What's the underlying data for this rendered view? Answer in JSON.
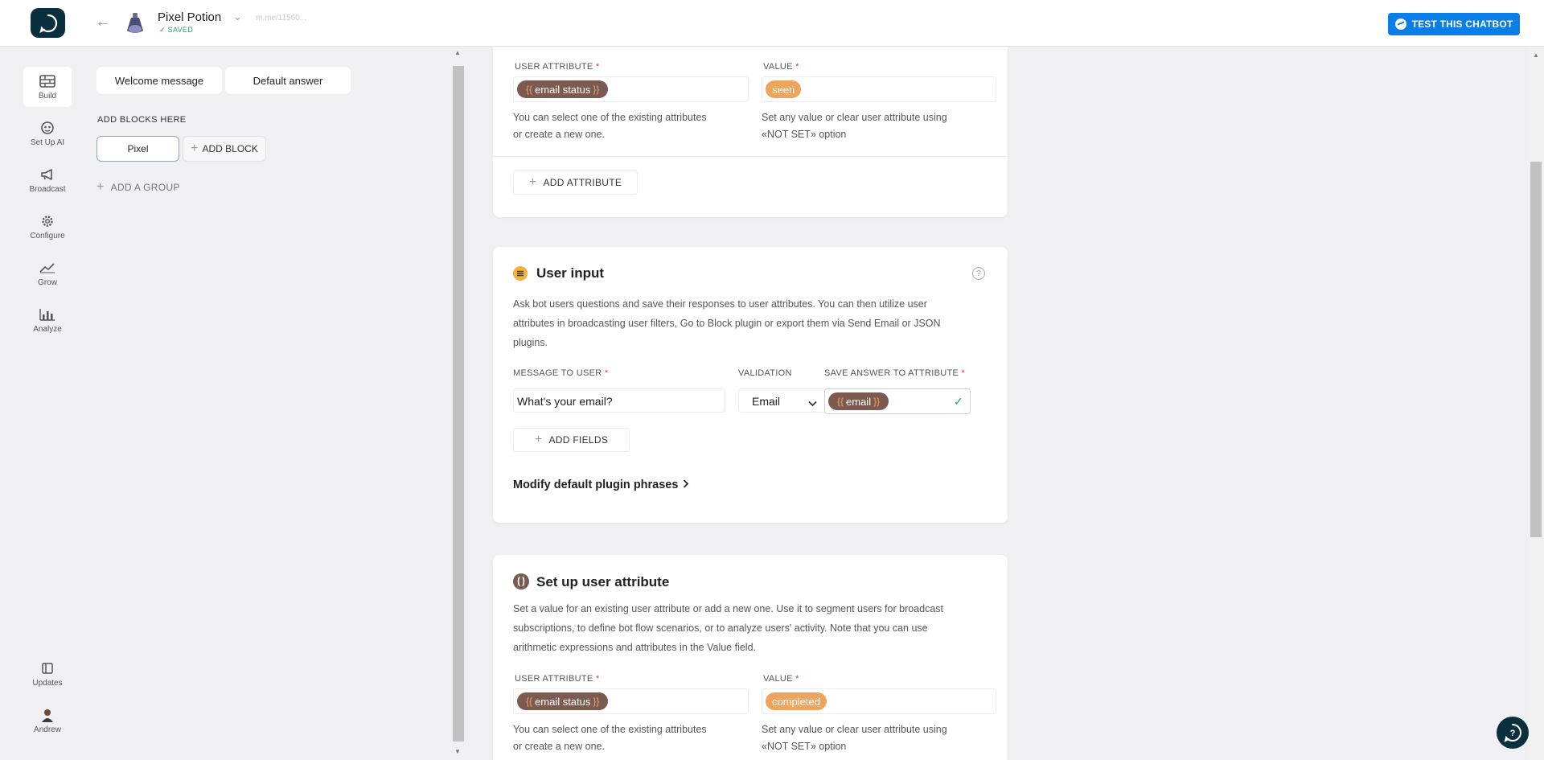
{
  "topbar": {
    "bot_name": "Pixel Potion",
    "saved_status": "SAVED",
    "bot_link": "m.me/11560...",
    "test_button": "TEST THIS CHATBOT"
  },
  "sidebar": {
    "items": [
      {
        "label": "Build",
        "icon": "build-icon",
        "active": true
      },
      {
        "label": "Set Up AI",
        "icon": "ai-icon",
        "active": false
      },
      {
        "label": "Broadcast",
        "icon": "megaphone-icon",
        "active": false
      },
      {
        "label": "Configure",
        "icon": "gear-icon",
        "active": false
      },
      {
        "label": "Grow",
        "icon": "grow-icon",
        "active": false
      },
      {
        "label": "Analyze",
        "icon": "chart-icon",
        "active": false
      }
    ],
    "updates_label": "Updates",
    "user_label": "Andrew"
  },
  "blocks_panel": {
    "welcome_tab": "Welcome message",
    "default_tab": "Default answer",
    "add_blocks_label": "ADD BLOCKS HERE",
    "pixel_block": "Pixel",
    "add_block": "ADD BLOCK",
    "add_group": "ADD A GROUP"
  },
  "attr_card_top": {
    "attr_label": "USER ATTRIBUTE",
    "value_label": "VALUE",
    "attr_chip": "email status",
    "value_chip": "seen",
    "attr_help_1": "You can select one of the existing attributes",
    "attr_help_2": "or create a new one.",
    "value_help_1": "Set any value or clear user attribute using",
    "value_help_2": "«NOT SET» option",
    "add_attribute": "ADD ATTRIBUTE"
  },
  "user_input_card": {
    "title": "User input",
    "desc_1": "Ask bot users questions and save their responses to user attributes. You can then utilize user",
    "desc_2": "attributes in broadcasting user filters, Go to Block plugin or export them via Send Email or JSON",
    "desc_3": "plugins.",
    "message_label": "MESSAGE TO USER",
    "validation_label": "VALIDATION",
    "save_label": "SAVE ANSWER TO ATTRIBUTE",
    "message_value": "What's your email?",
    "validation_value": "Email",
    "save_chip": "email",
    "add_fields": "ADD FIELDS",
    "modify_phrases": "Modify default plugin phrases"
  },
  "setup_attr_card": {
    "title": "Set up user attribute",
    "desc_1": "Set a value for an existing user attribute or add a new one. Use it to segment users for broadcast",
    "desc_2": "subscriptions, to define bot flow scenarios, or to analyze users' activity. Note that you can use",
    "desc_3": "arithmetic expressions and attributes in the Value field.",
    "attr_label": "USER ATTRIBUTE",
    "value_label": "VALUE",
    "attr_chip": "email status",
    "value_chip": "completed",
    "attr_help_1": "You can select one of the existing attributes",
    "attr_help_2": "or create a new one.",
    "value_help_1": "Set any value or clear user attribute using",
    "value_help_2": "«NOT SET» option"
  },
  "colors": {
    "accent": "#0b7de6",
    "brand_dark": "#0b2f3f",
    "attr_chip": "#7d5a50",
    "value_chip": "#eda45d",
    "saved_green": "#28a06a",
    "required_red": "#e53935"
  }
}
